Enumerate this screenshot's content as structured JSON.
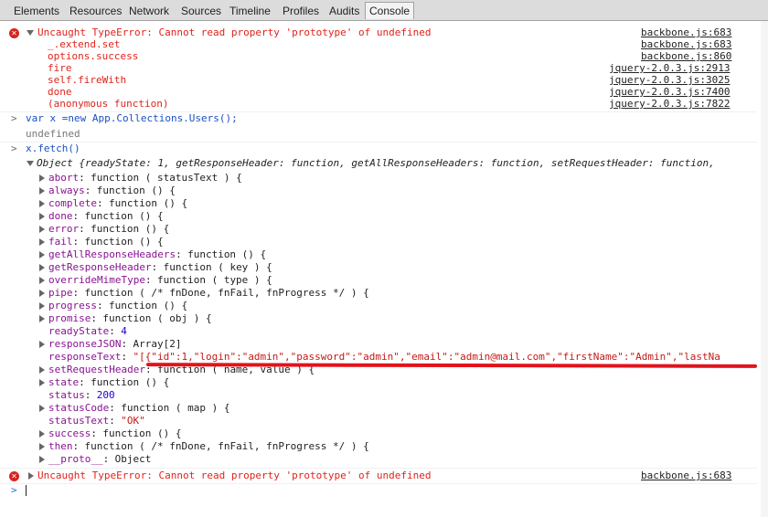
{
  "tabs": [
    "Elements",
    "Resources",
    "Network",
    "Sources",
    "Timeline",
    "Profiles",
    "Audits",
    "Console"
  ],
  "active_tab": "Console",
  "error1": {
    "message": "Uncaught TypeError: Cannot read property 'prototype' of undefined",
    "stack": [
      {
        "fn": "_.extend.set",
        "src": "backbone.js:683"
      },
      {
        "fn": "options.success",
        "src": "backbone.js:860"
      },
      {
        "fn": "fire",
        "src": "jquery-2.0.3.js:2913"
      },
      {
        "fn": "self.fireWith",
        "src": "jquery-2.0.3.js:3025"
      },
      {
        "fn": "done",
        "src": "jquery-2.0.3.js:7400"
      },
      {
        "fn": "(anonymous function)",
        "src": "jquery-2.0.3.js:7822"
      }
    ],
    "source": "backbone.js:683"
  },
  "input1": "var x =new App.Collections.Users();",
  "result1": "undefined",
  "input2": "x.fetch()",
  "object_summary": "Object {readyState: 1, getResponseHeader: function, getAllResponseHeaders: function, setRequestHeader: function,",
  "props": [
    {
      "key": "abort",
      "val": "function ( statusText ) {",
      "expand": true
    },
    {
      "key": "always",
      "val": "function () {",
      "expand": true
    },
    {
      "key": "complete",
      "val": "function () {",
      "expand": true
    },
    {
      "key": "done",
      "val": "function () {",
      "expand": true
    },
    {
      "key": "error",
      "val": "function () {",
      "expand": true
    },
    {
      "key": "fail",
      "val": "function () {",
      "expand": true
    },
    {
      "key": "getAllResponseHeaders",
      "val": "function () {",
      "expand": true
    },
    {
      "key": "getResponseHeader",
      "val": "function ( key ) {",
      "expand": true
    },
    {
      "key": "overrideMimeType",
      "val": "function ( type ) {",
      "expand": true
    },
    {
      "key": "pipe",
      "val": "function ( /* fnDone, fnFail, fnProgress */ ) {",
      "expand": true
    },
    {
      "key": "progress",
      "val": "function () {",
      "expand": true
    },
    {
      "key": "promise",
      "val": "function ( obj ) {",
      "expand": true
    },
    {
      "key": "readyState",
      "val": "4",
      "expand": false,
      "kind": "num"
    },
    {
      "key": "responseJSON",
      "val": "Array[2]",
      "expand": true
    },
    {
      "key": "responseText",
      "val": "\"[{\"id\":1,\"login\":\"admin\",\"password\":\"admin\",\"email\":\"admin@mail.com\",\"firstName\":\"Admin\",\"lastNa",
      "expand": false,
      "kind": "str"
    },
    {
      "key": "setRequestHeader",
      "val": "function ( name, value ) {",
      "expand": true
    },
    {
      "key": "state",
      "val": "function () {",
      "expand": true
    },
    {
      "key": "status",
      "val": "200",
      "expand": false,
      "kind": "num"
    },
    {
      "key": "statusCode",
      "val": "function ( map ) {",
      "expand": true
    },
    {
      "key": "statusText",
      "val": "\"OK\"",
      "expand": false,
      "kind": "str"
    },
    {
      "key": "success",
      "val": "function () {",
      "expand": true
    },
    {
      "key": "then",
      "val": "function ( /* fnDone, fnFail, fnProgress */ ) {",
      "expand": true
    },
    {
      "key": "__proto__",
      "val": "Object",
      "expand": true
    }
  ],
  "error2": {
    "message": "Uncaught TypeError: Cannot read property 'prototype' of undefined",
    "source": "backbone.js:683"
  },
  "prompt_symbol": ">",
  "icons": {
    "error": "error-circle-icon",
    "expand": "triangle-right-icon",
    "collapse": "triangle-down-icon"
  }
}
